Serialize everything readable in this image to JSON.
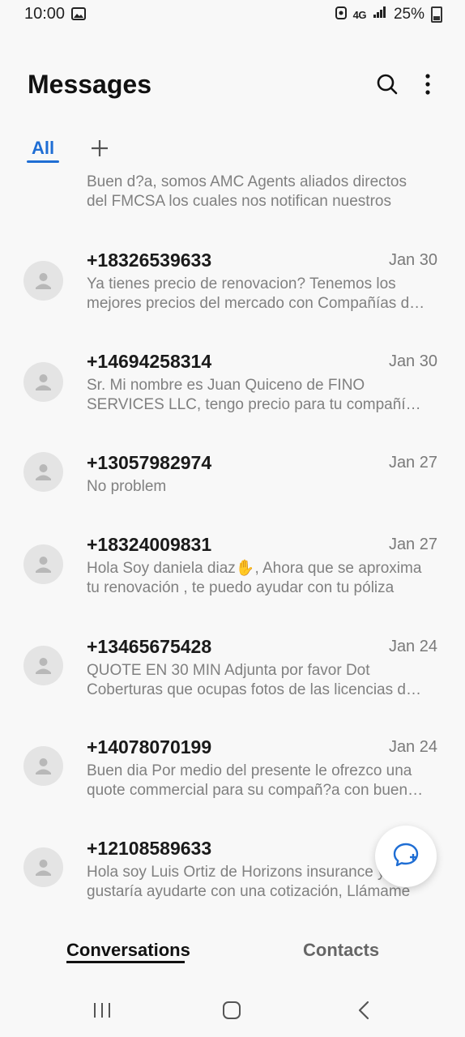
{
  "status_bar": {
    "time": "10:00",
    "network": "4G",
    "battery": "25%"
  },
  "header": {
    "title": "Messages",
    "search_icon": "search-icon",
    "more_icon": "more-vertical-icon"
  },
  "tabs": {
    "all_label": "All",
    "add_icon": "plus-icon"
  },
  "conversations": [
    {
      "name": "",
      "date": "",
      "preview": "Buen d?a, somos AMC Agents aliados directos del FMCSA los cuales nos notifican nuestros"
    },
    {
      "name": "+18326539633",
      "date": "Jan 30",
      "preview": "Ya tienes precio de renovacion? Tenemos los mejores precios del mercado con Compañías de seguro"
    },
    {
      "name": "+14694258314",
      "date": "Jan 30",
      "preview": "Sr. Mi nombre es Juan Quiceno de FINO SERVICES LLC, tengo precio para tu compañía de transporte"
    },
    {
      "name": "+13057982974",
      "date": "Jan 27",
      "preview": "No problem"
    },
    {
      "name": "+18324009831",
      "date": "Jan 27",
      "preview": "Hola Soy daniela diaz✋, Ahora que se aproxima tu renovación  , te puedo ayudar con tu póliza"
    },
    {
      "name": "+13465675428",
      "date": "Jan 24",
      "preview": "QUOTE EN 30 MIN   Adjunta por favor   Dot Coberturas que ocupas fotos de las licencias de conducir"
    },
    {
      "name": "+14078070199",
      "date": "Jan 24",
      "preview": "Buen dia  Por medio del presente le ofrezco una quote commercial para su compañ?a con buenos precios"
    },
    {
      "name": "+12108589633",
      "date": "",
      "preview": "Hola soy Luis Ortiz de Horizons insurance y me gustaría ayudarte con una cotización, Llámame"
    }
  ],
  "fab": {
    "icon": "new-message-icon"
  },
  "bottom_tabs": {
    "conversations": "Conversations",
    "contacts": "Contacts"
  },
  "nav": {
    "recents_icon": "recents-icon",
    "home_icon": "home-icon",
    "back_icon": "back-icon"
  }
}
